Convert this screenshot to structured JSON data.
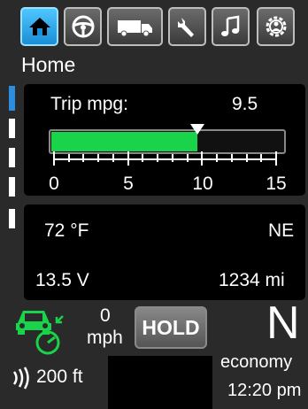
{
  "tabs": [
    {
      "name": "home-icon",
      "active": true
    },
    {
      "name": "steering-wheel-icon",
      "active": false
    },
    {
      "name": "truck-icon",
      "active": false
    },
    {
      "name": "wrench-icon",
      "active": false
    },
    {
      "name": "music-note-icon",
      "active": false
    },
    {
      "name": "settings-gear-icon",
      "active": false
    }
  ],
  "page": {
    "title": "Home"
  },
  "trip": {
    "label": "Trip mpg:",
    "value": "9.5",
    "gauge_fraction": 0.63,
    "scale_labels": [
      "0",
      "5",
      "10",
      "15"
    ],
    "bar_color": "#19d34a"
  },
  "info": {
    "temperature": "72 °F",
    "heading": "NE",
    "voltage": "13.5 V",
    "distance": "1234 mi"
  },
  "cruise": {
    "speed_value": "0",
    "speed_unit": "mph",
    "hold_label": "HOLD",
    "icon_color": "#19d34a"
  },
  "following": {
    "distance": "200 ft"
  },
  "gear": {
    "value": "N",
    "mode": "economy"
  },
  "clock": {
    "time": "12:20 pm"
  }
}
